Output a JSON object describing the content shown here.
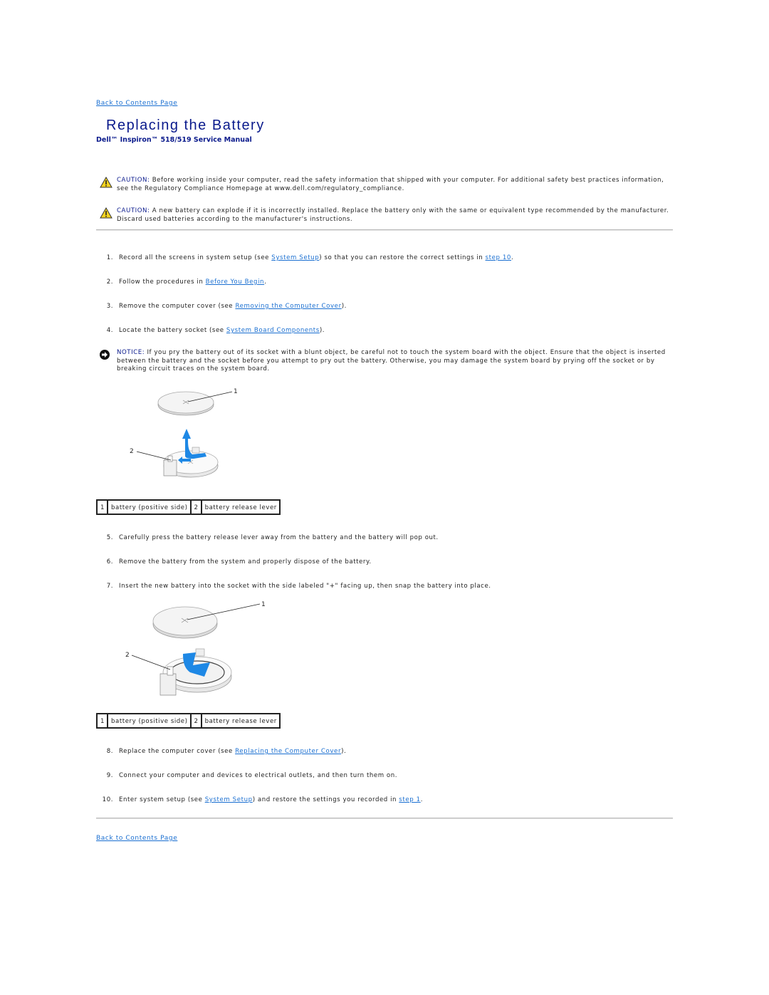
{
  "nav": {
    "back_top": "Back to Contents Page",
    "back_bottom": "Back to Contents Page"
  },
  "header": {
    "title": "Replacing the Battery",
    "subtitle": "Dell™ Inspiron™ 518/519 Service Manual"
  },
  "cautions": [
    {
      "icon": "warning-triangle-icon",
      "label": "CAUTION:",
      "text": " Before working inside your computer, read the safety information that shipped with your computer. For additional safety best practices information, see the Regulatory Compliance Homepage at www.dell.com/regulatory_compliance."
    },
    {
      "icon": "warning-triangle-icon",
      "label": "CAUTION:",
      "text": " A new battery can explode if it is incorrectly installed. Replace the battery only with the same or equivalent type recommended by the manufacturer. Discard used batteries according to the manufacturer's instructions."
    }
  ],
  "notice": {
    "icon": "notice-arrow-icon",
    "label": "NOTICE:",
    "text": " If you pry the battery out of its socket with a blunt object, be careful not to touch the system board with the object. Ensure that the object is inserted between the battery and the socket before you attempt to pry out the battery. Otherwise, you may damage the system board by prying off the socket or by breaking circuit traces on the system board."
  },
  "steps": [
    {
      "num": "1.",
      "before": "Record all the screens in system setup (see ",
      "link": "System Setup",
      "middle": ") so that you can restore the correct settings in ",
      "link2": "step 10",
      "after": "."
    },
    {
      "num": "2.",
      "before": "Follow the procedures in ",
      "link": "Before You Begin",
      "after": "."
    },
    {
      "num": "3.",
      "before": "Remove the computer cover (see ",
      "link": "Removing the Computer Cover",
      "after": ")."
    },
    {
      "num": "4.",
      "before": "Locate the battery socket (see ",
      "link": "System Board Components",
      "after": ")."
    },
    {
      "num": "5.",
      "text": "Carefully press the battery release lever away from the battery and the battery will pop out."
    },
    {
      "num": "6.",
      "text": "Remove the battery from the system and properly dispose of the battery."
    },
    {
      "num": "7.",
      "text": "Insert the new battery into the socket with the side labeled \"+\" facing up, then snap the battery into place."
    },
    {
      "num": "8.",
      "before": "Replace the computer cover (see ",
      "link": "Replacing the Computer Cover",
      "after": ")."
    },
    {
      "num": "9.",
      "text": "Connect your computer and devices to electrical outlets, and then turn them on."
    },
    {
      "num": "10.",
      "before": "Enter system setup (see ",
      "link": "System Setup",
      "middle": ") and restore the settings you recorded in ",
      "link2": "step 1",
      "after": "."
    }
  ],
  "figures": [
    {
      "name": "battery-removal-illustration",
      "callouts": [
        "1",
        "2"
      ],
      "legend": [
        {
          "num": "1",
          "label": "battery (positive side)"
        },
        {
          "num": "2",
          "label": "battery release lever"
        }
      ]
    },
    {
      "name": "battery-install-illustration",
      "callouts": [
        "1",
        "2"
      ],
      "legend": [
        {
          "num": "1",
          "label": "battery (positive side)"
        },
        {
          "num": "2",
          "label": "battery release lever"
        }
      ]
    }
  ],
  "colors": {
    "link": "#1a6fd1",
    "title": "#0a1a8c",
    "arrow": "#1e88e5",
    "rule": "#b8b8b8"
  }
}
